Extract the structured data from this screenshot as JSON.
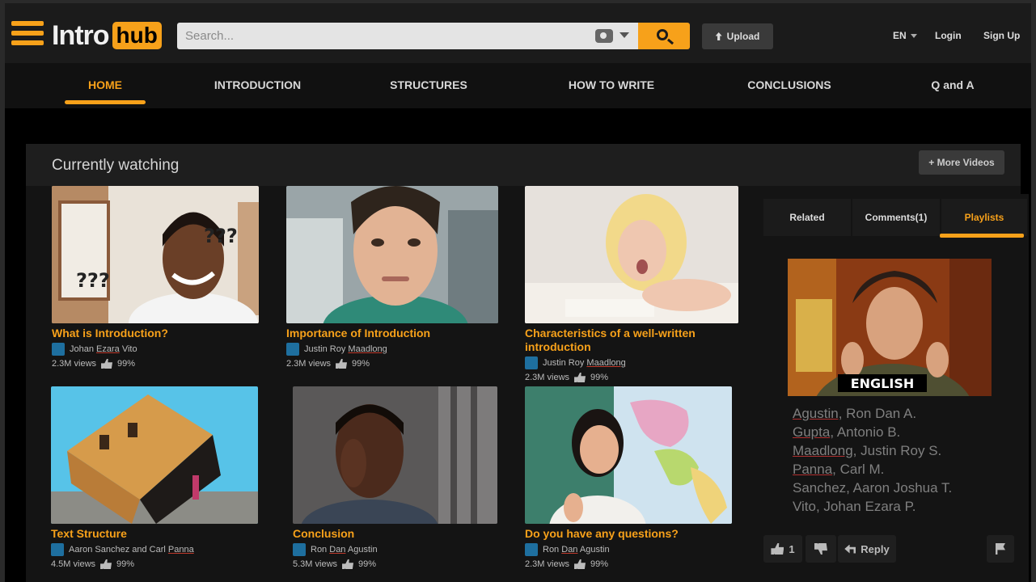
{
  "brand": {
    "intro": "Intro",
    "hub": "hub",
    "accent": "#f7a11a"
  },
  "search": {
    "placeholder": "Search...",
    "camera_icon": "camera-icon",
    "search_icon": "search-icon"
  },
  "header": {
    "upload_label": "Upload",
    "lang_label": "EN",
    "login_label": "Login",
    "signup_label": "Sign Up"
  },
  "nav": {
    "items": [
      {
        "label": "HOME",
        "active": true
      },
      {
        "label": "INTRODUCTION",
        "active": false
      },
      {
        "label": "STRUCTURES",
        "active": false
      },
      {
        "label": "HOW TO WRITE",
        "active": false
      },
      {
        "label": "CONCLUSIONS",
        "active": false
      },
      {
        "label": "Q and A",
        "active": false
      }
    ]
  },
  "panel": {
    "title": "Currently watching",
    "more_label": "+ More Videos"
  },
  "videos": [
    {
      "title": "What is Introduction?",
      "author_a": "Johan ",
      "author_u": "Ezara",
      "author_b": " Vito",
      "views": "2.3M views",
      "rating": "99%"
    },
    {
      "title": "Importance of Introduction",
      "author_a": "Justin Roy ",
      "author_u": "Maadlong",
      "author_b": "",
      "views": "2.3M views",
      "rating": "99%"
    },
    {
      "title": "Characteristics of a well-written introduction",
      "author_a": "Justin Roy ",
      "author_u": "Maadlong",
      "author_b": "",
      "views": "2.3M views",
      "rating": "99%"
    },
    {
      "title": "Text Structure",
      "author_a": "Aaron Sanchez and Carl ",
      "author_u": "Panna",
      "author_b": "",
      "views": "4.5M views",
      "rating": "99%"
    },
    {
      "title": "Conclusion",
      "author_a": "Ron ",
      "author_u": "Dan",
      "author_b": " Agustin",
      "views": "5.3M views",
      "rating": "99%"
    },
    {
      "title": "Do you have any questions?",
      "author_a": "Ron ",
      "author_u": "Dan",
      "author_b": " Agustin",
      "views": "2.3M views",
      "rating": "99%"
    }
  ],
  "sidebar": {
    "tabs": [
      {
        "label": "Related",
        "active": false
      },
      {
        "label": "Comments(1)",
        "active": false
      },
      {
        "label": "Playlists",
        "active": true
      }
    ],
    "playlist_caption": "ENGLISH",
    "credits": [
      {
        "u": "Agustin,",
        "rest": " Ron Dan A."
      },
      {
        "u": "Gupta",
        "rest": ", Antonio B."
      },
      {
        "u": "Maadlong",
        "rest": ", Justin Roy S."
      },
      {
        "u": "Panna",
        "rest": ", Carl M."
      },
      {
        "u": "",
        "rest": "Sanchez, Aaron Joshua T."
      },
      {
        "u": "",
        "rest": "Vito, Johan Ezara P."
      }
    ],
    "like_count": "1",
    "reply_label": "Reply"
  }
}
